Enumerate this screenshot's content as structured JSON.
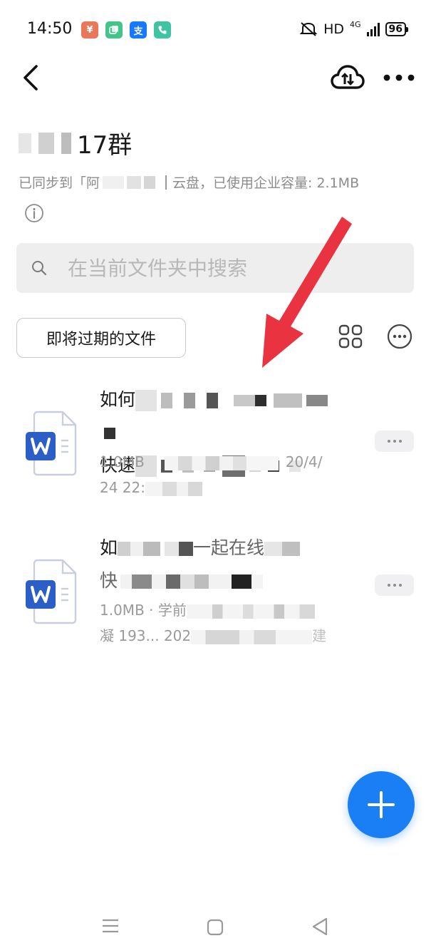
{
  "status_bar": {
    "time": "14:50",
    "network": "HD",
    "network_gen": "4G",
    "battery": "96",
    "notification_icons": [
      {
        "name": "app-notification-icon",
        "glyph": "¥",
        "color": "#e9785a"
      },
      {
        "name": "chat-notification-icon",
        "glyph": "",
        "color": "#45c48a"
      },
      {
        "name": "alipay-notification-icon",
        "glyph": "支",
        "color": "#1677ff"
      },
      {
        "name": "phone-notification-icon",
        "glyph": "",
        "color": "#3fc3a2"
      }
    ]
  },
  "header": {
    "title_suffix": "17群",
    "sync_prefix": "已同步到「阿",
    "sync_suffix": "云盘，已使用企业容量: 2.1MB"
  },
  "search": {
    "placeholder": "在当前文件夹中搜索"
  },
  "filters": {
    "expiring_label": "即将过期的文件"
  },
  "files": [
    {
      "name_line1": "如何",
      "name_line2": "快速",
      "meta_line1_start": "1.0MB",
      "meta_line1_end": "20/4/",
      "meta_line2": "24 22:"
    },
    {
      "name_line1_a": "如",
      "name_line1_b": "一起在线",
      "name_line2": "快",
      "meta_line1_start": "1.0MB · 学前",
      "meta_line2_start": "凝 193... 202",
      "meta_line2_end": "建"
    }
  ],
  "colors": {
    "accent": "#1a7ef5",
    "annotation_arrow": "#ea3340",
    "word_icon_blue": "#2b5fc7"
  }
}
